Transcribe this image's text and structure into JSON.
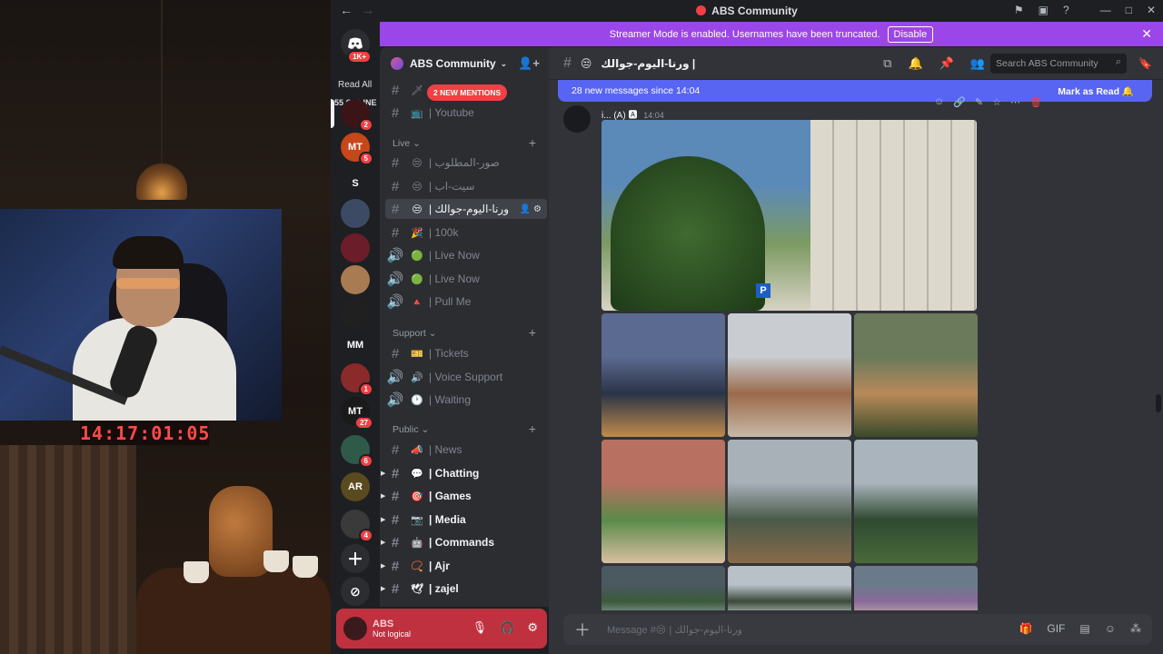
{
  "stream": {
    "timer": "14:17:01:05"
  },
  "window": {
    "title": "ABS Community",
    "back_icon": "arrow-left-icon",
    "forward_icon": "arrow-right-icon"
  },
  "banner": {
    "text": "Streamer Mode is enabled. Usernames have been truncated.",
    "button": "Disable"
  },
  "guilds": {
    "read_all": "Read All",
    "read_all_badge": "1K+",
    "online": "55 ONLINE",
    "items": [
      {
        "label": "",
        "badge": "2",
        "color": "#3a1416"
      },
      {
        "label": "MT",
        "badge": "5",
        "color": "#c7461a"
      },
      {
        "label": "S",
        "badge": "",
        "color": "#1e1f22"
      },
      {
        "label": "",
        "badge": "",
        "color": "#3c4a63"
      },
      {
        "label": "",
        "badge": "",
        "color": "#6b1d2a"
      },
      {
        "label": "",
        "badge": "",
        "color": "#a87b52"
      },
      {
        "label": "",
        "badge": "",
        "color": "#202020"
      },
      {
        "label": "MM",
        "badge": "",
        "color": "#1e1f22"
      },
      {
        "label": "",
        "badge": "1",
        "color": "#8a2a2a"
      },
      {
        "label": "MT",
        "badge": "27",
        "color": "#1a1a1a"
      },
      {
        "label": "",
        "badge": "6",
        "color": "#2f5a4a"
      },
      {
        "label": "AR",
        "badge": "",
        "color": "#5a4a20"
      },
      {
        "label": "",
        "badge": "4",
        "color": "#3a3a3a"
      }
    ]
  },
  "server": {
    "name": "ABS Community",
    "mentions_pill": "2 NEW MENTIONS",
    "channels_top": [
      {
        "emoji": "🗡",
        "name": "",
        "unread": false
      },
      {
        "emoji": "📺",
        "name": "| Youtube",
        "unread": false
      }
    ],
    "categories": [
      {
        "name": "Live",
        "channels": [
          {
            "icon": "#",
            "emoji": "😒",
            "name": "| صور-المطلوب",
            "unread": false,
            "active": false
          },
          {
            "icon": "#",
            "emoji": "😒",
            "name": "| سيت-اب",
            "unread": false,
            "active": false
          },
          {
            "icon": "#",
            "emoji": "😒",
            "name": "| ورنا-اليوم-جوالك",
            "unread": false,
            "active": true
          },
          {
            "icon": "#",
            "emoji": "🎉",
            "name": "| 100k",
            "unread": false,
            "active": false
          },
          {
            "icon": "🔊",
            "emoji": "🟢",
            "name": "| Live Now",
            "unread": false,
            "active": false
          },
          {
            "icon": "🔊",
            "emoji": "🟢",
            "name": "| Live Now",
            "unread": false,
            "active": false
          },
          {
            "icon": "🔊",
            "emoji": "🔺",
            "name": "| Pull Me",
            "unread": false,
            "active": false
          }
        ]
      },
      {
        "name": "Support",
        "channels": [
          {
            "icon": "#",
            "emoji": "🎫",
            "name": "| Tickets",
            "unread": false,
            "active": false
          },
          {
            "icon": "🔊",
            "emoji": "🔊",
            "name": "| Voice Support",
            "unread": false,
            "active": false
          },
          {
            "icon": "🔊",
            "emoji": "🕐",
            "name": "| Waiting",
            "unread": false,
            "active": false
          }
        ]
      },
      {
        "name": "Public",
        "channels": [
          {
            "icon": "#",
            "emoji": "📣",
            "name": "| News",
            "unread": false,
            "active": false
          },
          {
            "icon": "#",
            "emoji": "💬",
            "name": "| Chatting",
            "unread": true,
            "active": false
          },
          {
            "icon": "#",
            "emoji": "🎯",
            "name": "| Games",
            "unread": true,
            "active": false
          },
          {
            "icon": "#",
            "emoji": "📷",
            "name": "| Media",
            "unread": true,
            "active": false
          },
          {
            "icon": "#",
            "emoji": "🤖",
            "name": "| Commands",
            "unread": true,
            "active": false
          },
          {
            "icon": "#",
            "emoji": "📿",
            "name": "| Ajr",
            "unread": true,
            "active": false
          },
          {
            "icon": "#",
            "emoji": "🕊",
            "name": "| zajel",
            "unread": true,
            "active": false
          }
        ]
      }
    ]
  },
  "user": {
    "name": "ABS",
    "status": "Not logical"
  },
  "channel_header": {
    "name": "ورنا-اليوم-جوالك |",
    "emoji": "😒",
    "search_placeholder": "Search ABS Community"
  },
  "new_messages": {
    "text": "28 new messages since 14:04",
    "mark": "Mark as Read"
  },
  "message": {
    "author": "i... (A)",
    "time": "14:04",
    "tiles": [
      {
        "scene": "street-building",
        "colors": [
          "#5c8ab8",
          "#7c9a62",
          "#d8d3c5"
        ]
      },
      {
        "scene": "river-castle",
        "colors": [
          "#5a6a90",
          "#2a3448",
          "#c08a4a"
        ]
      },
      {
        "scene": "flag-tower",
        "colors": [
          "#c9ccd0",
          "#9a6a4a",
          "#c8b8a8"
        ]
      },
      {
        "scene": "deer",
        "colors": [
          "#6a7a5a",
          "#b88a5a",
          "#3a4a2a"
        ]
      },
      {
        "scene": "flowers",
        "colors": [
          "#b87060",
          "#5a8a4a",
          "#d8c0a0"
        ]
      },
      {
        "scene": "mountains",
        "colors": [
          "#a8b0b8",
          "#4a5a48",
          "#8a6a4a"
        ]
      },
      {
        "scene": "forest",
        "colors": [
          "#aab4bc",
          "#2f4a30",
          "#4a6a3a"
        ]
      },
      {
        "scene": "lake",
        "colors": [
          "#4a5a60",
          "#3a5a3a",
          "#a0a8b0"
        ]
      },
      {
        "scene": "snow-trees",
        "colors": [
          "#b8c0c8",
          "#3a4a3a",
          "#e0e4e8"
        ]
      },
      {
        "scene": "market",
        "colors": [
          "#6a7a8a",
          "#8a6a9a",
          "#c8b8a8"
        ]
      }
    ]
  },
  "composer": {
    "placeholder": "Message #😒 | ورنا-اليوم-جوالك"
  }
}
